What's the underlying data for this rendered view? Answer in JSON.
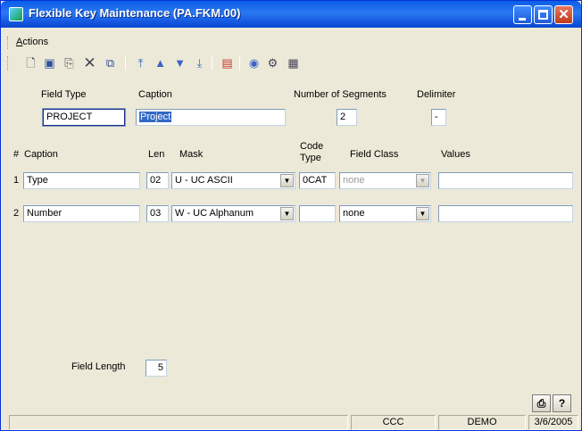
{
  "window": {
    "title": "Flexible Key Maintenance (PA.FKM.00)"
  },
  "menu": {
    "actions_prefix": "A",
    "actions_rest": "ctions"
  },
  "toolbar": {
    "icons": [
      "new-icon",
      "save-icon",
      "copy-icon",
      "delete-icon",
      "paste-icon",
      "first-icon",
      "previous-icon",
      "next-icon",
      "last-icon",
      "notes-icon",
      "help-icon",
      "customize-icon",
      "template-icon"
    ]
  },
  "header": {
    "field_type_label": "Field Type",
    "caption_label": "Caption",
    "num_segments_label": "Number of Segments",
    "delimiter_label": "Delimiter",
    "field_type_value": "PROJECT",
    "caption_value": "Project",
    "num_segments_value": "2",
    "delimiter_value": "-"
  },
  "grid": {
    "col_num": "#",
    "col_caption": "Caption",
    "col_len": "Len",
    "col_mask": "Mask",
    "col_code_type_1": "Code",
    "col_code_type_2": "Type",
    "col_field_class": "Field Class",
    "col_values": "Values",
    "rows": [
      {
        "num": "1",
        "caption": "Type",
        "len": "02",
        "mask": "U - UC ASCII",
        "code_type": "0CAT",
        "field_class": "none",
        "values": ""
      },
      {
        "num": "2",
        "caption": "Number",
        "len": "03",
        "mask": "W - UC Alphanum",
        "code_type": "",
        "field_class": "none",
        "values": ""
      }
    ]
  },
  "footer": {
    "field_length_label": "Field Length",
    "field_length_value": "5"
  },
  "status": {
    "panel_1": "",
    "company": "CCC",
    "database": "DEMO",
    "date": "3/6/2005"
  }
}
